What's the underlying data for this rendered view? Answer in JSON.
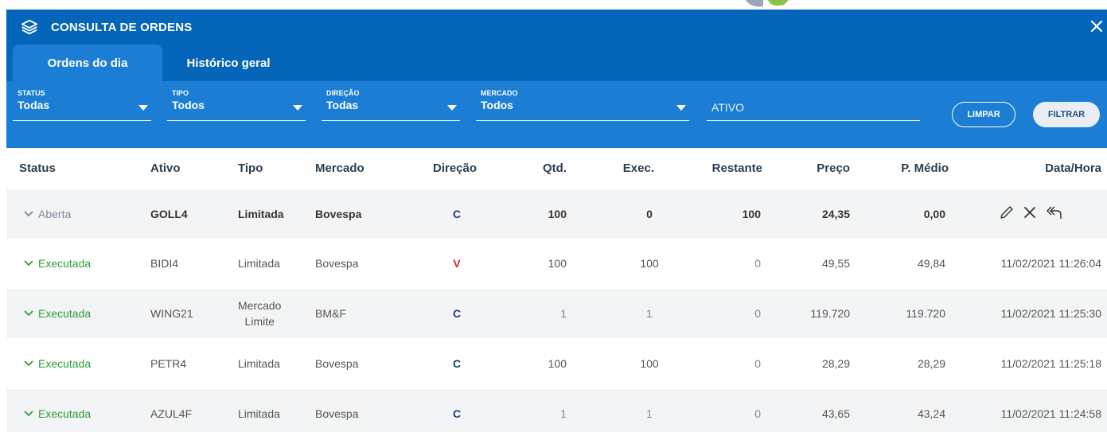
{
  "panel": {
    "title": "CONSULTA DE ORDENS",
    "icons": {
      "title_icon": "layers-icon",
      "close": "close-icon"
    }
  },
  "tabs": [
    {
      "label": "Ordens do dia",
      "active": true
    },
    {
      "label": "Histórico geral",
      "active": false
    }
  ],
  "filters": {
    "status": {
      "label": "STATUS",
      "value": "Todas"
    },
    "tipo": {
      "label": "TIPO",
      "value": "Todos"
    },
    "direcao": {
      "label": "DIREÇÃO",
      "value": "Todas"
    },
    "mercado": {
      "label": "MERCADO",
      "value": "Todos"
    },
    "ativo": {
      "placeholder": "ATIVO",
      "value": ""
    },
    "limpar_label": "LIMPAR",
    "filtrar_label": "FILTRAR"
  },
  "columns": [
    "Status",
    "Ativo",
    "Tipo",
    "Mercado",
    "Direção",
    "Qtd.",
    "Exec.",
    "Restante",
    "Preço",
    "P. Médio",
    "Data/Hora"
  ],
  "rows": [
    {
      "status": "Aberta",
      "ativo": "GOLL4",
      "tipo": "Limitada",
      "mercado": "Bovespa",
      "direcao": "C",
      "qtd": "100",
      "exec": "0",
      "restante": "100",
      "preco": "24,35",
      "pmedio": "0,00",
      "datahora": ""
    },
    {
      "status": "Executada",
      "ativo": "BIDI4",
      "tipo": "Limitada",
      "mercado": "Bovespa",
      "direcao": "V",
      "qtd": "100",
      "exec": "100",
      "restante": "0",
      "preco": "49,55",
      "pmedio": "49,84",
      "datahora": "11/02/2021 11:26:04"
    },
    {
      "status": "Executada",
      "ativo": "WING21",
      "tipo_line1": "Mercado",
      "tipo_line2": "Limite",
      "mercado": "BM&F",
      "direcao": "C",
      "qtd": "1",
      "exec": "1",
      "restante": "0",
      "preco": "119.720",
      "pmedio": "119.720",
      "datahora": "11/02/2021 11:25:30"
    },
    {
      "status": "Executada",
      "ativo": "PETR4",
      "tipo": "Limitada",
      "mercado": "Bovespa",
      "direcao": "C",
      "qtd": "100",
      "exec": "100",
      "restante": "0",
      "preco": "28,29",
      "pmedio": "28,29",
      "datahora": "11/02/2021 11:25:18"
    },
    {
      "status": "Executada",
      "ativo": "AZUL4F",
      "tipo": "Limitada",
      "mercado": "Bovespa",
      "direcao": "C",
      "qtd": "1",
      "exec": "1",
      "restante": "0",
      "preco": "43,65",
      "pmedio": "43,24",
      "datahora": "11/02/2021 11:24:58"
    }
  ],
  "row_actions": [
    "edit-icon",
    "cancel-icon",
    "reply-all-icon"
  ],
  "colors": {
    "header_blue": "#0565b8",
    "filter_blue": "#1b7ed4",
    "executed_green": "#2e9b3a",
    "sell_red": "#d22b2b",
    "buy_navy": "#1c3d7a"
  }
}
